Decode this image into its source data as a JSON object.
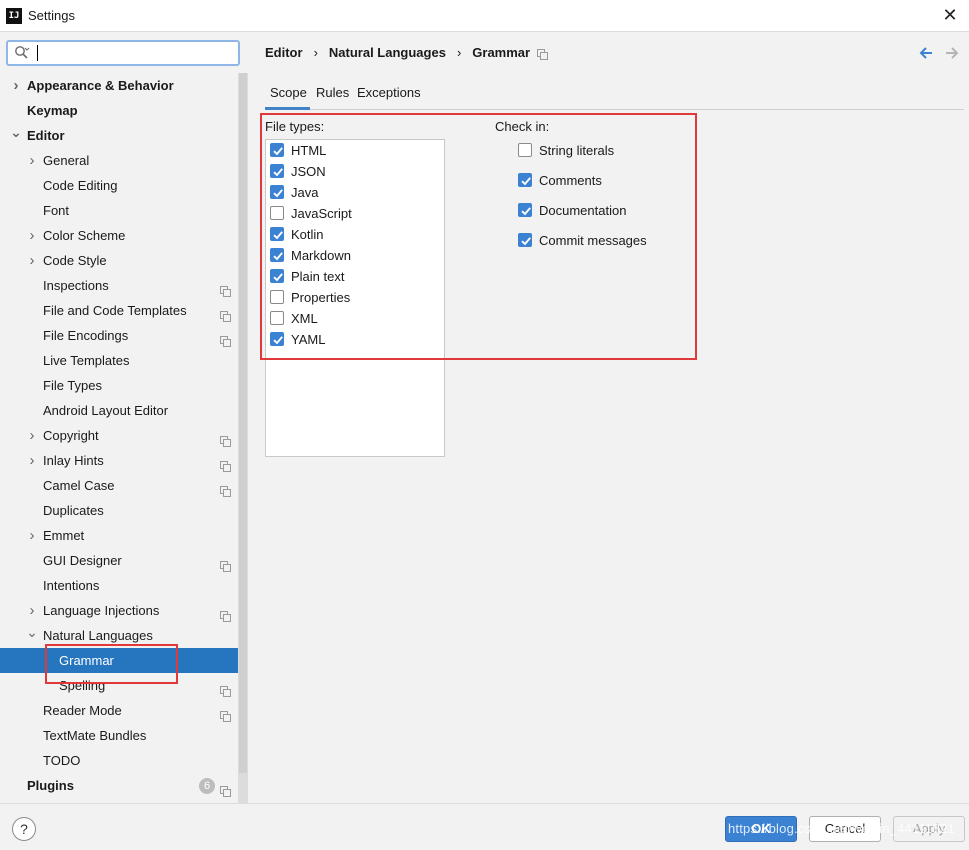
{
  "window": {
    "title": "Settings",
    "app_icon": "IJ"
  },
  "sidebar": {
    "tree": [
      {
        "label": "Appearance & Behavior",
        "bold": true,
        "arrow": "right",
        "indent": 0
      },
      {
        "label": "Keymap",
        "bold": true,
        "arrow": "",
        "indent": 0
      },
      {
        "label": "Editor",
        "bold": true,
        "arrow": "down",
        "indent": 0
      },
      {
        "label": "General",
        "arrow": "right",
        "indent": 1
      },
      {
        "label": "Code Editing",
        "arrow": "",
        "indent": 1
      },
      {
        "label": "Font",
        "arrow": "",
        "indent": 1
      },
      {
        "label": "Color Scheme",
        "arrow": "right",
        "indent": 1
      },
      {
        "label": "Code Style",
        "arrow": "right",
        "indent": 1
      },
      {
        "label": "Inspections",
        "arrow": "",
        "indent": 1,
        "project": true
      },
      {
        "label": "File and Code Templates",
        "arrow": "",
        "indent": 1,
        "project": true
      },
      {
        "label": "File Encodings",
        "arrow": "",
        "indent": 1,
        "project": true
      },
      {
        "label": "Live Templates",
        "arrow": "",
        "indent": 1
      },
      {
        "label": "File Types",
        "arrow": "",
        "indent": 1
      },
      {
        "label": "Android Layout Editor",
        "arrow": "",
        "indent": 1
      },
      {
        "label": "Copyright",
        "arrow": "right",
        "indent": 1,
        "project": true
      },
      {
        "label": "Inlay Hints",
        "arrow": "right",
        "indent": 1,
        "project": true
      },
      {
        "label": "Camel Case",
        "arrow": "",
        "indent": 1,
        "project": true
      },
      {
        "label": "Duplicates",
        "arrow": "",
        "indent": 1
      },
      {
        "label": "Emmet",
        "arrow": "right",
        "indent": 1
      },
      {
        "label": "GUI Designer",
        "arrow": "",
        "indent": 1,
        "project": true
      },
      {
        "label": "Intentions",
        "arrow": "",
        "indent": 1
      },
      {
        "label": "Language Injections",
        "arrow": "right",
        "indent": 1,
        "project": true
      },
      {
        "label": "Natural Languages",
        "arrow": "down",
        "indent": 1
      },
      {
        "label": "Grammar",
        "arrow": "",
        "indent": 2,
        "selected": true
      },
      {
        "label": "Spelling",
        "arrow": "",
        "indent": 2,
        "project": true
      },
      {
        "label": "Reader Mode",
        "arrow": "",
        "indent": 1,
        "project": true
      },
      {
        "label": "TextMate Bundles",
        "arrow": "",
        "indent": 1
      },
      {
        "label": "TODO",
        "arrow": "",
        "indent": 1
      },
      {
        "label": "Plugins",
        "bold": true,
        "arrow": "",
        "indent": 0,
        "badge": "6",
        "project": true
      }
    ]
  },
  "breadcrumb": {
    "items": [
      "Editor",
      "Natural Languages",
      "Grammar"
    ],
    "separator": "›"
  },
  "tabs": [
    "Scope",
    "Rules",
    "Exceptions"
  ],
  "scope": {
    "file_types_label": "File types:",
    "file_types": [
      {
        "label": "HTML",
        "checked": true
      },
      {
        "label": "JSON",
        "checked": true
      },
      {
        "label": "Java",
        "checked": true
      },
      {
        "label": "JavaScript",
        "checked": false
      },
      {
        "label": "Kotlin",
        "checked": true
      },
      {
        "label": "Markdown",
        "checked": true
      },
      {
        "label": "Plain text",
        "checked": true
      },
      {
        "label": "Properties",
        "checked": false
      },
      {
        "label": "XML",
        "checked": false
      },
      {
        "label": "YAML",
        "checked": true
      }
    ],
    "check_in_label": "Check in:",
    "check_in": [
      {
        "label": "String literals",
        "checked": false
      },
      {
        "label": "Comments",
        "checked": true
      },
      {
        "label": "Documentation",
        "checked": true
      },
      {
        "label": "Commit messages",
        "checked": true
      }
    ]
  },
  "buttons": {
    "help": "?",
    "ok": "OK",
    "cancel": "Cancel",
    "apply": "Apply"
  },
  "watermark": "https://blog.csdn.net/weixin_44111821",
  "colors": {
    "accent": "#3c82d2",
    "selection": "#2675bf",
    "highlight_box": "#e0393b"
  }
}
